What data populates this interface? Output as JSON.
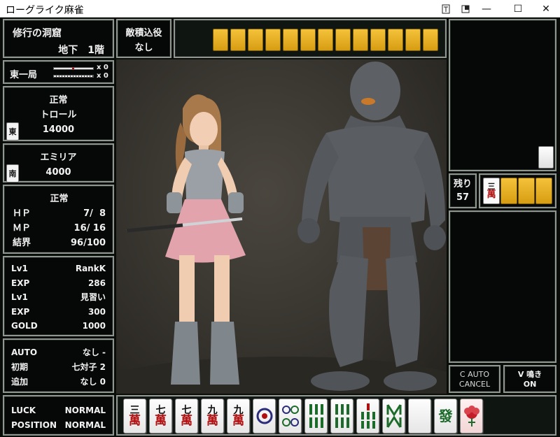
{
  "window": {
    "title": "ローグライク麻雀",
    "pin_icon": "pin-icon",
    "restore_icon": "restore-icon",
    "min_label": "—",
    "max_label": "☐",
    "close_label": "✕"
  },
  "dungeon": {
    "name": "修行の洞窟",
    "floor": "地下　1階"
  },
  "yaku": {
    "title": "敵積込役",
    "value": "なし"
  },
  "round": {
    "label": "東一局",
    "honba": "x 0",
    "riichi": "x 0"
  },
  "enemy": {
    "status": "正常",
    "name": "トロール",
    "seat": "東",
    "points": "14000"
  },
  "player": {
    "name": "エミリア",
    "seat": "南",
    "points": "4000"
  },
  "vitals": {
    "status": "正常",
    "hp_label": "ＨＰ",
    "hp": "7/  8",
    "mp_label": "ＭＰ",
    "mp": "16/ 16",
    "barrier_label": "結界",
    "barrier": "96/100"
  },
  "stats": [
    {
      "k": "Lv1",
      "v": "RankK"
    },
    {
      "k": "EXP",
      "v": "286"
    },
    {
      "k": "Lv1",
      "v": "見習い"
    },
    {
      "k": "EXP",
      "v": "300"
    },
    {
      "k": "GOLD",
      "v": "1000"
    }
  ],
  "options": [
    {
      "k": "AUTO",
      "v": "なし -"
    },
    {
      "k": "初期",
      "v": "七対子 2"
    },
    {
      "k": "追加",
      "v": "なし 0"
    }
  ],
  "luck": {
    "luck_label": "LUCK",
    "luck": "NORMAL",
    "pos_label": "POSITION",
    "pos": "NORMAL"
  },
  "wall": {
    "remain_label": "残り",
    "remain": "57",
    "dora": {
      "n": "三",
      "m": "萬"
    }
  },
  "buttons": {
    "c_auto": "C AUTO",
    "cancel": "CANCEL",
    "v_naki": "V 鳴き",
    "on": "ON"
  },
  "hand": [
    {
      "n": "三",
      "m": "萬"
    },
    {
      "n": "七",
      "m": "萬"
    },
    {
      "n": "七",
      "m": "萬"
    },
    {
      "n": "九",
      "m": "萬"
    },
    {
      "n": "九",
      "m": "萬"
    },
    {
      "icon": "pin-1-icon"
    },
    {
      "icon": "pin-4-icon"
    },
    {
      "icon": "sou-6-icon"
    },
    {
      "icon": "sou-6-icon"
    },
    {
      "icon": "sou-8-icon"
    },
    {
      "icon": "sou-7-icon"
    },
    {
      "icon": "haku-icon"
    },
    {
      "n": "發",
      "m": ""
    },
    {
      "icon": "flower-icon"
    }
  ],
  "colors": {
    "panel_border": "#8f9791",
    "tile_back": "#e3ab1c",
    "manzu_red": "#b10f0f",
    "text": "#f2f2f2"
  }
}
